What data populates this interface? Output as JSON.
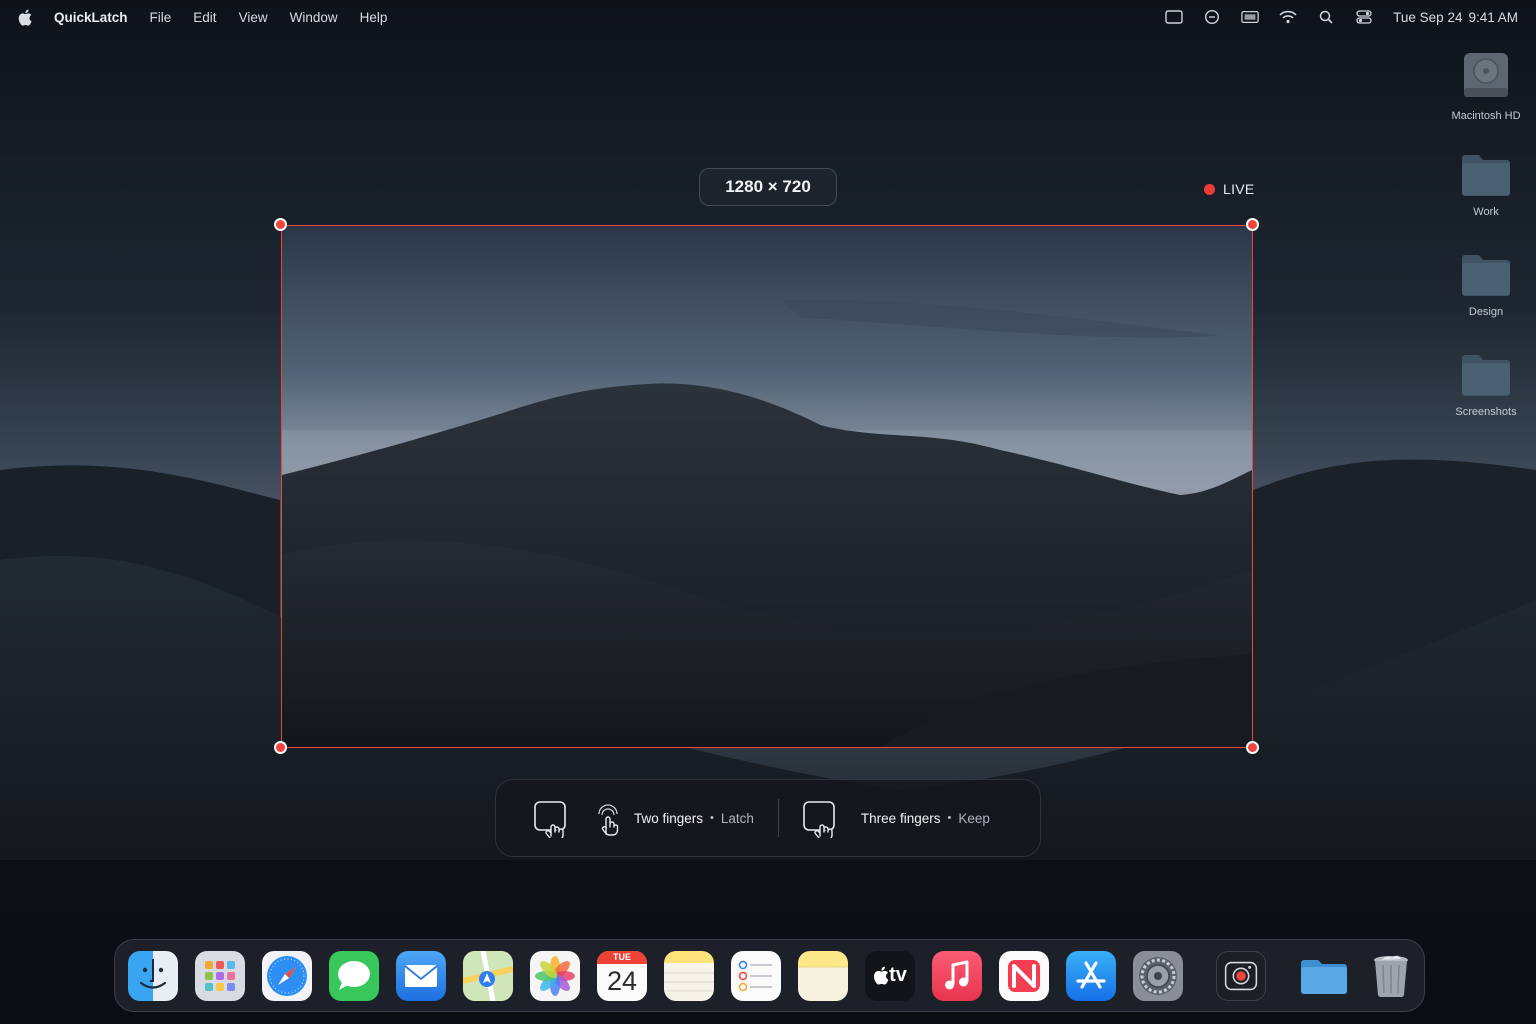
{
  "menubar": {
    "app_name": "QuickLatch",
    "menus": [
      "File",
      "Edit",
      "View",
      "Window",
      "Help"
    ],
    "clock_date": "Tue Sep 24",
    "clock_time": "9:41 AM"
  },
  "desktop": {
    "items": [
      {
        "label": "Macintosh HD",
        "icon": "hard-drive-icon"
      },
      {
        "label": "Work",
        "icon": "folder-icon"
      },
      {
        "label": "Design",
        "icon": "folder-icon"
      },
      {
        "label": "Screenshots",
        "icon": "folder-icon"
      }
    ]
  },
  "capture": {
    "dimensions": "1280 × 720",
    "live_label": "LIVE",
    "accent_color": "#f0433b"
  },
  "gestures": {
    "two_fingers_label": "Two fingers",
    "two_fingers_action": "Latch",
    "three_fingers_label": "Three fingers",
    "three_fingers_action": "Keep",
    "separator": "•"
  },
  "dock": {
    "calendar_month": "TUE",
    "calendar_day": "24",
    "tv_label": "tv",
    "apps": [
      "finder-icon",
      "launchpad-icon",
      "safari-icon",
      "messages-icon",
      "mail-icon",
      "maps-icon",
      "photos-icon",
      "calendar-icon",
      "notes-icon",
      "reminders-icon",
      "stickies-icon",
      "apple-tv-icon",
      "music-icon",
      "news-icon",
      "app-store-icon",
      "system-settings-icon",
      "screen-recorder-icon",
      "downloads-folder-icon",
      "trash-icon"
    ]
  }
}
